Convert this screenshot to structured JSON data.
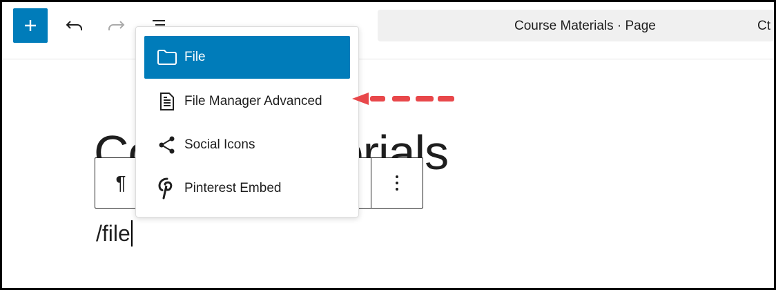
{
  "toolbar": {
    "add_icon": "plus-icon",
    "undo_icon": "undo-icon",
    "redo_icon": "redo-icon",
    "outline_icon": "list-view-icon",
    "document_title": "Course Materials · Page",
    "shortcut_hint": "Ct"
  },
  "editor": {
    "heading_text": "Course Materials",
    "slash_command": "/file"
  },
  "block_toolbar": {
    "paragraph_symbol": "¶",
    "more_icon": "vertical-ellipsis-icon"
  },
  "inserter_menu": {
    "items": [
      {
        "label": "File",
        "icon": "folder-icon",
        "selected": true
      },
      {
        "label": "File Manager Advanced",
        "icon": "document-icon",
        "selected": false
      },
      {
        "label": "Social Icons",
        "icon": "share-icon",
        "selected": false
      },
      {
        "label": "Pinterest Embed",
        "icon": "pinterest-icon",
        "selected": false
      }
    ]
  },
  "colors": {
    "accent": "#007cba",
    "annotation_arrow": "#e8474a"
  }
}
